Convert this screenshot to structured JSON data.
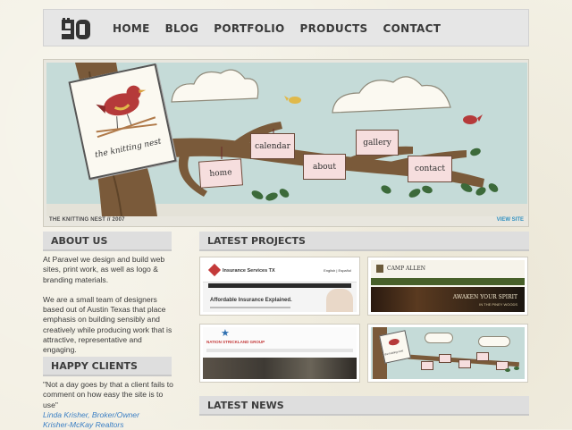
{
  "nav": {
    "logo_text": "9D",
    "items": [
      "HOME",
      "BLOG",
      "PORTFOLIO",
      "PRODUCTS",
      "CONTACT"
    ]
  },
  "hero": {
    "card_title": "the knitting nest",
    "signs": [
      "home",
      "calendar",
      "about",
      "gallery",
      "contact"
    ],
    "caption": "THE KNITTING NEST  //  2007",
    "view_site": "VIEW SITE"
  },
  "about": {
    "heading": "ABOUT US",
    "p1": "At Paravel we design and build web sites, print work, as well as logo & branding materials.",
    "p2": "We are a small team of designers based out of Austin Texas that place emphasis on building sensibly and creatively while producing work that is attractive, representative and engaging."
  },
  "clients": {
    "heading": "HAPPY CLIENTS",
    "quote": "\"Not a day goes by that a client fails to comment on how easy the site is to use\"",
    "name": "Linda Krisher, Broker/Owner",
    "company": "Krisher-McKay Realtors"
  },
  "projects": {
    "heading": "LATEST PROJECTS",
    "insurance": {
      "brand": "Insurance Services TX",
      "headline": "Affordable Insurance Explained.",
      "lang": "English | Español"
    },
    "camp": {
      "brand": "CAMP ALLEN",
      "tagline": "AWAKEN YOUR SPIRIT",
      "sub": "IN THE PINEY WOODS"
    },
    "group": {
      "brand": "NATION STRICKLAND GROUP"
    },
    "nest": {
      "title": "the knitting nest"
    }
  },
  "news": {
    "heading": "LATEST NEWS"
  },
  "colors": {
    "sky": "#c5dbd8",
    "bark": "#7a5a3a",
    "sign": "#f6dede",
    "bird": "#b53a3a",
    "link": "#3b7fc4"
  }
}
